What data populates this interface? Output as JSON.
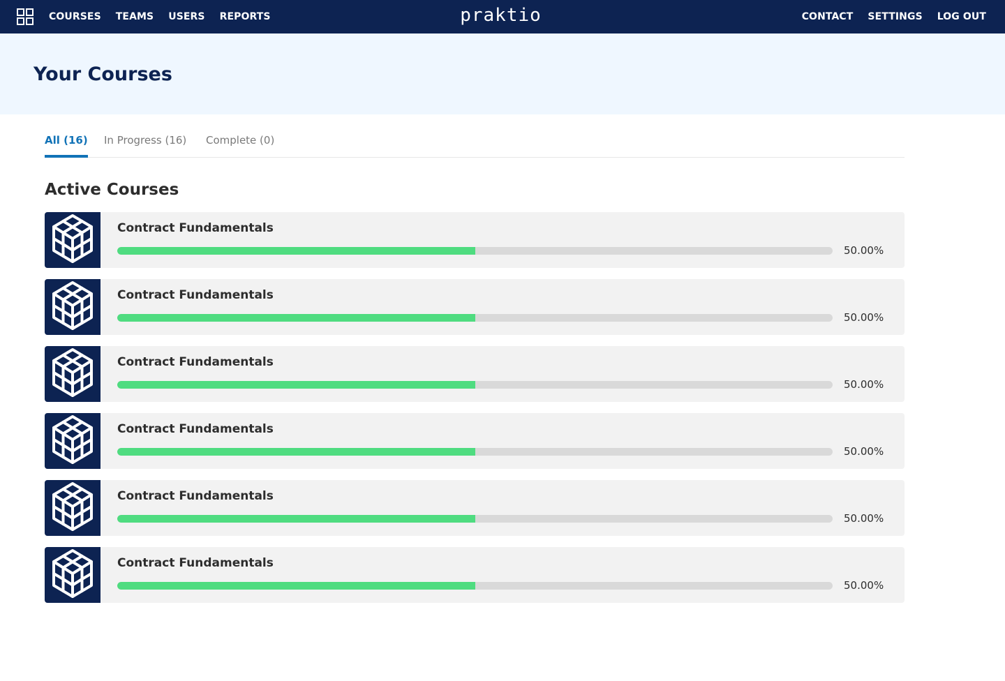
{
  "nav": {
    "brand": "praktio",
    "left_links": [
      "COURSES",
      "TEAMS",
      "USERS",
      "REPORTS"
    ],
    "right_links": [
      "CONTACT",
      "SETTINGS",
      "LOG OUT"
    ],
    "apps_icon": "grid-apps-icon"
  },
  "page": {
    "title": "Your Courses"
  },
  "tabs": [
    {
      "label": "All (16)",
      "active": true
    },
    {
      "label": "In Progress (16)",
      "active": false
    },
    {
      "label": "Complete (0)",
      "active": false
    }
  ],
  "section": {
    "title": "Active Courses"
  },
  "courses": [
    {
      "title": "Contract Fundamentals",
      "progress": 0.5,
      "progress_label": "50.00%",
      "icon": "cube-stack-icon"
    },
    {
      "title": "Contract Fundamentals",
      "progress": 0.5,
      "progress_label": "50.00%",
      "icon": "cube-stack-icon"
    },
    {
      "title": "Contract Fundamentals",
      "progress": 0.5,
      "progress_label": "50.00%",
      "icon": "cube-stack-icon"
    },
    {
      "title": "Contract Fundamentals",
      "progress": 0.5,
      "progress_label": "50.00%",
      "icon": "cube-stack-icon"
    },
    {
      "title": "Contract Fundamentals",
      "progress": 0.5,
      "progress_label": "50.00%",
      "icon": "cube-stack-icon"
    },
    {
      "title": "Contract Fundamentals",
      "progress": 0.5,
      "progress_label": "50.00%",
      "icon": "cube-stack-icon"
    }
  ],
  "colors": {
    "nav_bg": "#0d2352",
    "hero_bg": "#eff7ff",
    "accent": "#1273b7",
    "progress": "#4fdc80"
  }
}
